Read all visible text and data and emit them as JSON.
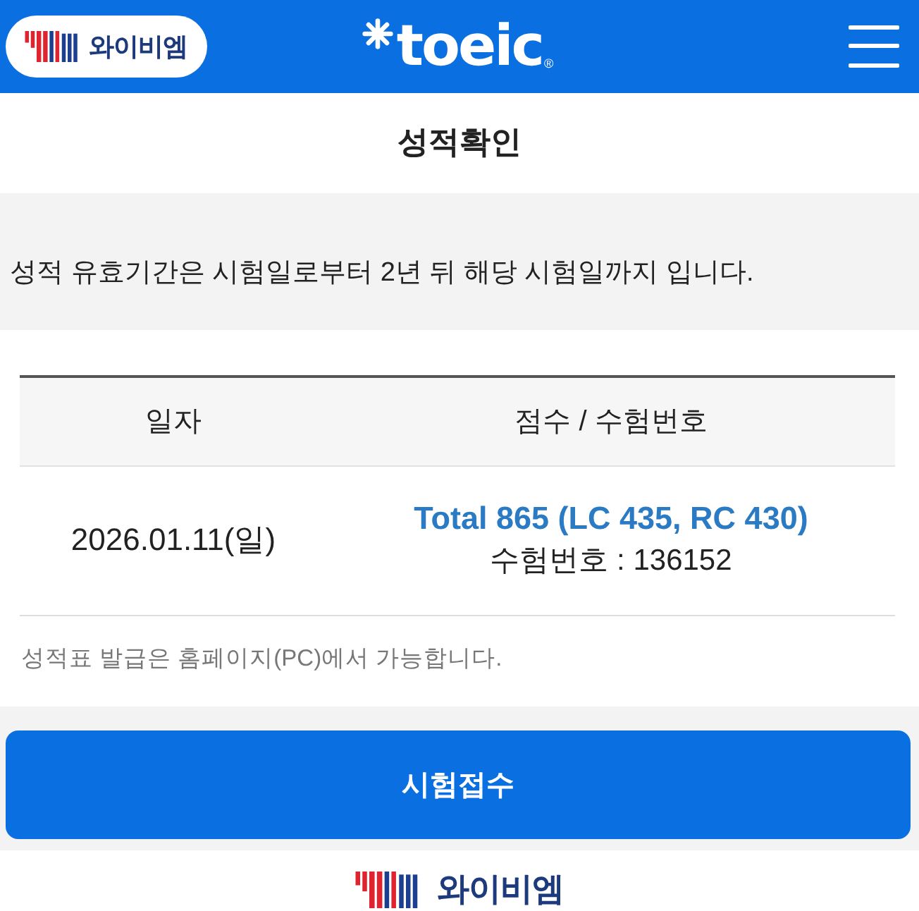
{
  "header": {
    "brand": "와이비엠",
    "logo": "toeic",
    "logo_mark": "®"
  },
  "page_title": "성적확인",
  "notice": "성적 유효기간은 시험일로부터 2년 뒤 해당 시험일까지 입니다.",
  "score_table": {
    "columns": [
      "일자",
      "점수 / 수험번호"
    ],
    "rows": [
      {
        "date": "2026.01.11(일)",
        "score": "Total 865 (LC 435, RC 430)",
        "exam_number": "수험번호 : 136152"
      }
    ]
  },
  "table_note": "성적표 발급은 홈페이지(PC)에서 가능합니다.",
  "primary_button": "시험접수",
  "footer": {
    "brand": "와이비엠"
  }
}
